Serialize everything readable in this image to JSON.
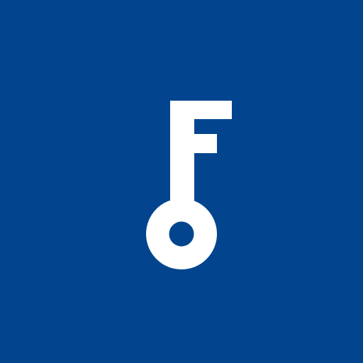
{
  "app_icon": {
    "name": "key-logo",
    "background_color": "#02458e",
    "foreground_color": "#ffffff",
    "icon": "key-with-f-bit-icon"
  }
}
